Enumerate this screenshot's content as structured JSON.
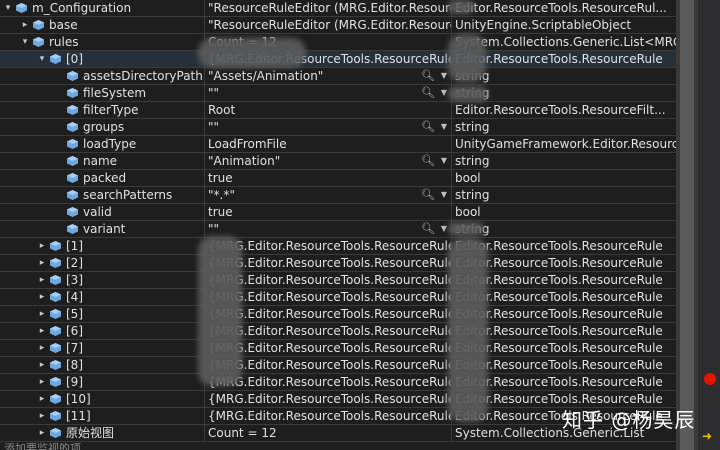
{
  "rows": [
    {
      "indent": 0,
      "expander": "▾",
      "icon": "variable-icon",
      "name": "m_Configuration",
      "value": "\"ResourceRuleEditor (MRG.Editor.ResourceT...",
      "type": "Editor.ResourceTools.ResourceRul...",
      "search": false
    },
    {
      "indent": 1,
      "expander": "▸",
      "icon": "object-icon",
      "name": "base",
      "value": "\"ResourceRuleEditor (MRG.Editor.ResourceT...",
      "type": "UnityEngine.ScriptableObject",
      "search": false
    },
    {
      "indent": 1,
      "expander": "▾",
      "icon": "object-icon",
      "name": "rules",
      "value": "Count = 12",
      "type": "System.Collections.Generic.List<MRG.E...",
      "search": false
    },
    {
      "indent": 2,
      "expander": "▾",
      "icon": "object-icon",
      "name": "[0]",
      "value": "{MRG.Editor.ResourceTools.ResourceRule}",
      "type": "Editor.ResourceTools.ResourceRule",
      "search": false
    },
    {
      "indent": 3,
      "expander": "",
      "icon": "field-icon",
      "name": "assetsDirectoryPath",
      "value": "\"Assets/Animation\"",
      "type": "string",
      "search": true
    },
    {
      "indent": 3,
      "expander": "",
      "icon": "field-icon",
      "name": "fileSystem",
      "value": "\"\"",
      "type": "string",
      "search": true
    },
    {
      "indent": 3,
      "expander": "",
      "icon": "field-icon",
      "name": "filterType",
      "value": "Root",
      "type": "Editor.ResourceTools.ResourceFilt...",
      "search": false
    },
    {
      "indent": 3,
      "expander": "",
      "icon": "field-icon",
      "name": "groups",
      "value": "\"\"",
      "type": "string",
      "search": true
    },
    {
      "indent": 3,
      "expander": "",
      "icon": "field-icon",
      "name": "loadType",
      "value": "LoadFromFile",
      "type": "UnityGameFramework.Editor.ResourceT...",
      "search": false
    },
    {
      "indent": 3,
      "expander": "",
      "icon": "field-icon",
      "name": "name",
      "value": "\"Animation\"",
      "type": "string",
      "search": true
    },
    {
      "indent": 3,
      "expander": "",
      "icon": "field-icon",
      "name": "packed",
      "value": "true",
      "type": "bool",
      "search": false
    },
    {
      "indent": 3,
      "expander": "",
      "icon": "field-icon",
      "name": "searchPatterns",
      "value": "\"*.*\"",
      "type": "string",
      "search": true
    },
    {
      "indent": 3,
      "expander": "",
      "icon": "field-icon",
      "name": "valid",
      "value": "true",
      "type": "bool",
      "search": false
    },
    {
      "indent": 3,
      "expander": "",
      "icon": "field-icon",
      "name": "variant",
      "value": "\"\"",
      "type": "string",
      "search": true
    },
    {
      "indent": 2,
      "expander": "▸",
      "icon": "object-icon",
      "name": "[1]",
      "value": "{MRG.Editor.ResourceTools.ResourceRule}",
      "type": "Editor.ResourceTools.ResourceRule",
      "search": false
    },
    {
      "indent": 2,
      "expander": "▸",
      "icon": "object-icon",
      "name": "[2]",
      "value": "{MRG.Editor.ResourceTools.ResourceRule}",
      "type": "Editor.ResourceTools.ResourceRule",
      "search": false
    },
    {
      "indent": 2,
      "expander": "▸",
      "icon": "object-icon",
      "name": "[3]",
      "value": "{MRG.Editor.ResourceTools.ResourceRule}",
      "type": "Editor.ResourceTools.ResourceRule",
      "search": false
    },
    {
      "indent": 2,
      "expander": "▸",
      "icon": "object-icon",
      "name": "[4]",
      "value": "{MRG.Editor.ResourceTools.ResourceRule}",
      "type": "Editor.ResourceTools.ResourceRule",
      "search": false
    },
    {
      "indent": 2,
      "expander": "▸",
      "icon": "object-icon",
      "name": "[5]",
      "value": "{MRG.Editor.ResourceTools.ResourceRule}",
      "type": "Editor.ResourceTools.ResourceRule",
      "search": false
    },
    {
      "indent": 2,
      "expander": "▸",
      "icon": "object-icon",
      "name": "[6]",
      "value": "{MRG.Editor.ResourceTools.ResourceRule}",
      "type": "Editor.ResourceTools.ResourceRule",
      "search": false
    },
    {
      "indent": 2,
      "expander": "▸",
      "icon": "object-icon",
      "name": "[7]",
      "value": "{MRG.Editor.ResourceTools.ResourceRule}",
      "type": "Editor.ResourceTools.ResourceRule",
      "search": false
    },
    {
      "indent": 2,
      "expander": "▸",
      "icon": "object-icon",
      "name": "[8]",
      "value": "{MRG.Editor.ResourceTools.ResourceRule}",
      "type": "Editor.ResourceTools.ResourceRule",
      "search": false
    },
    {
      "indent": 2,
      "expander": "▸",
      "icon": "object-icon",
      "name": "[9]",
      "value": "{MRG.Editor.ResourceTools.ResourceRule}",
      "type": "Editor.ResourceTools.ResourceRule",
      "search": false
    },
    {
      "indent": 2,
      "expander": "▸",
      "icon": "object-icon",
      "name": "[10]",
      "value": "{MRG.Editor.ResourceTools.ResourceRule}",
      "type": "Editor.ResourceTools.ResourceRule",
      "search": false
    },
    {
      "indent": 2,
      "expander": "▸",
      "icon": "object-icon",
      "name": "[11]",
      "value": "{MRG.Editor.ResourceTools.ResourceRule}",
      "type": "Editor.ResourceTools.ResourceRule",
      "search": false
    },
    {
      "indent": 2,
      "expander": "▸",
      "icon": "object-icon",
      "name": "原始视图",
      "value": "Count = 12",
      "type": "System.Collections.Generic.List",
      "search": false
    }
  ],
  "footer_hint": "添加要监视的项",
  "watermark": "知乎 @杨昊辰",
  "colors": {
    "icon": "#6ea8de",
    "background": "#1e1e1e",
    "grid": "#3a3a3a",
    "breakpoint": "#e51400",
    "selected": "#26303a"
  }
}
